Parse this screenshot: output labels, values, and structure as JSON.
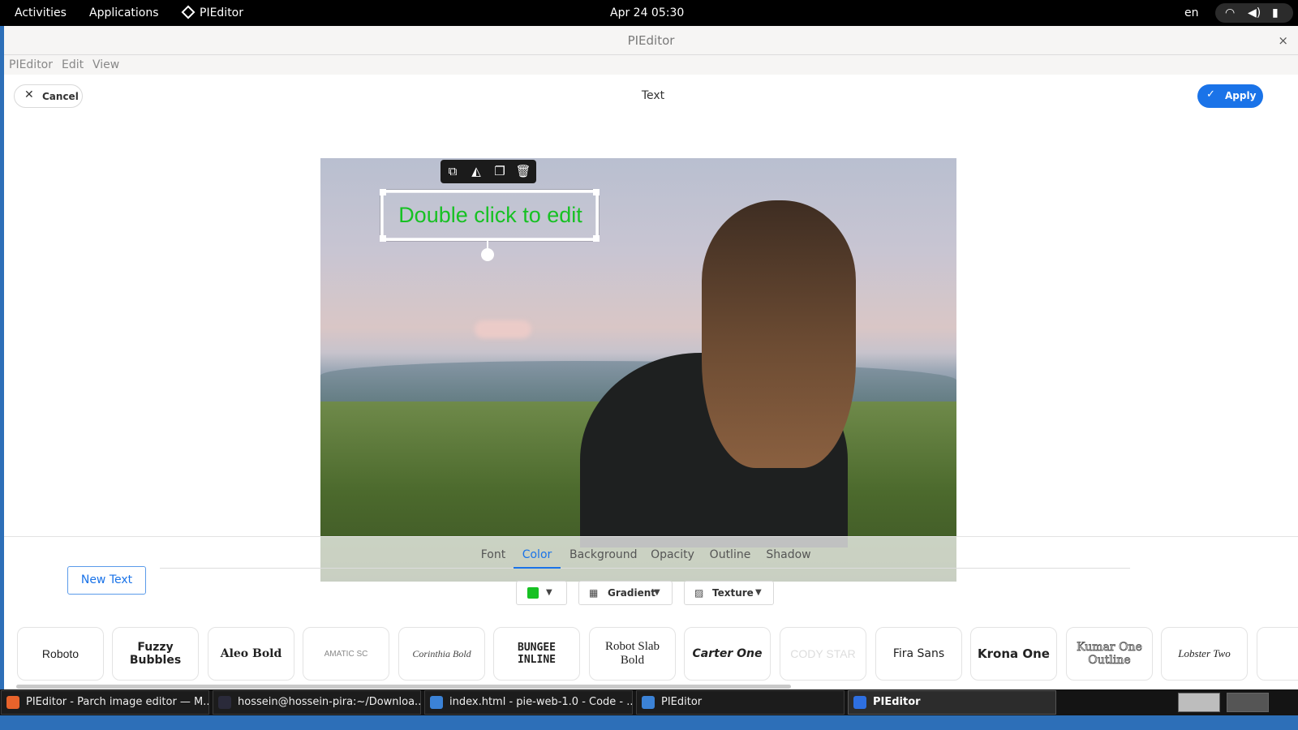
{
  "topbar": {
    "activities": "Activities",
    "applications": "Applications",
    "app_name": "PIEditor",
    "clock": "Apr 24  05:30",
    "lang": "en",
    "status_icons": [
      "wifi-icon",
      "volume-icon",
      "battery-icon"
    ]
  },
  "window": {
    "title": "PIEditor",
    "close": "×",
    "menu": [
      "PIEditor",
      "Edit",
      "View"
    ]
  },
  "header": {
    "cancel_label": "Cancel",
    "cancel_icon": "✕",
    "title": "Text",
    "apply_label": "Apply",
    "apply_icon": "✓"
  },
  "text_object": {
    "content": "Double click to edit",
    "color": "#17c123",
    "toolbar_icons": [
      "duplicate-icon",
      "flip-icon",
      "bring-to-front-icon",
      "delete-icon"
    ]
  },
  "panel": {
    "new_text_label": "New Text",
    "tabs": [
      "Font",
      "Color",
      "Background",
      "Opacity",
      "Outline",
      "Shadow"
    ],
    "active_tab": "Color",
    "color_dropdown": {
      "swatch": "#17c123",
      "icon": "chevron-down-icon"
    },
    "gradient_label": "Gradient",
    "texture_label": "Texture",
    "fonts": [
      "Roboto",
      "Fuzzy Bubbles",
      "Aleo Bold",
      "AMATIC SC",
      "Corinthia Bold",
      "BUNGEE INLINE",
      "Robot Slab Bold",
      "Carter One",
      "CODY STAR",
      "Fira Sans",
      "Krona One",
      "Kumar One Outline",
      "Lobster Two"
    ]
  },
  "taskbar": {
    "items": [
      {
        "label": "PIEditor - Parch image editor — M...",
        "icon": "firefox-icon",
        "color": "#e8632b"
      },
      {
        "label": "hossein@hossein-pira:~/Downloa...",
        "icon": "terminal-icon",
        "color": "#2a2a3a"
      },
      {
        "label": "index.html - pie-web-1.0 - Code - ...",
        "icon": "vscode-icon",
        "color": "#3b82d6"
      },
      {
        "label": "PIEditor",
        "icon": "document-icon",
        "color": "#3b82d6"
      },
      {
        "label": "PIEditor",
        "icon": "pieditor-icon",
        "color": "#2e6fe0"
      }
    ]
  }
}
